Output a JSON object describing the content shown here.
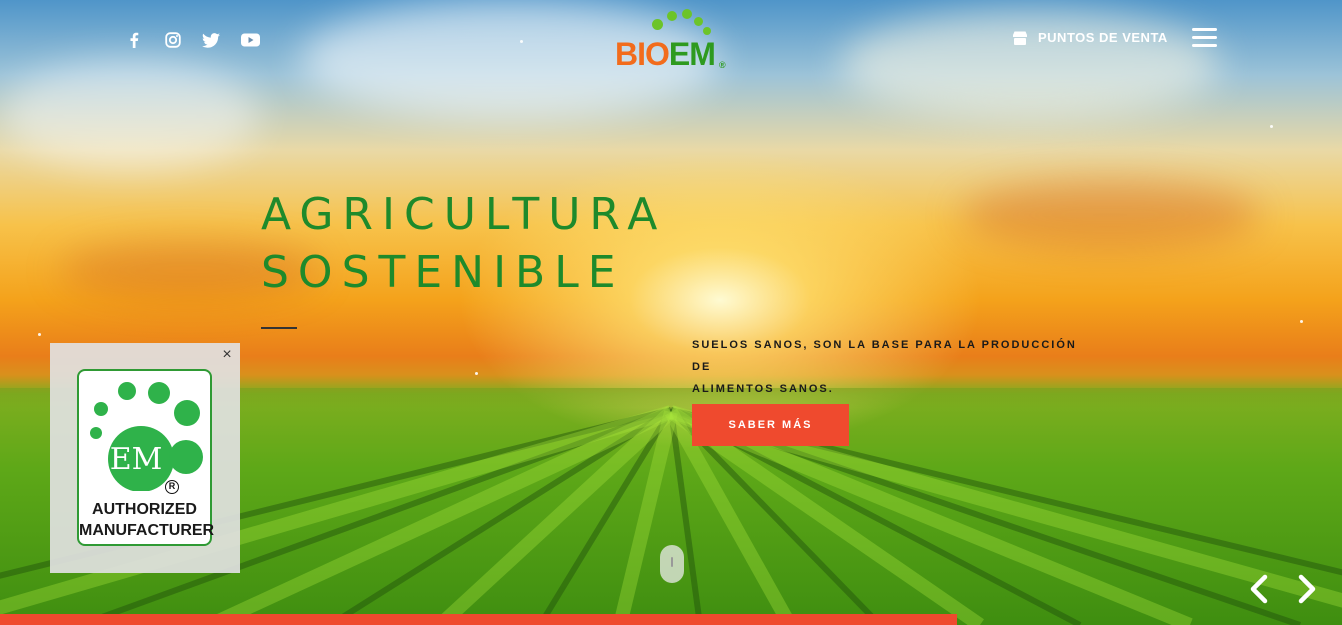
{
  "header": {
    "social": [
      {
        "icon": "facebook-icon"
      },
      {
        "icon": "instagram-icon"
      },
      {
        "icon": "twitter-icon"
      },
      {
        "icon": "youtube-icon"
      }
    ],
    "logo": {
      "part1": "BIO",
      "part2": "EM",
      "reg": "®"
    },
    "store_link": {
      "icon": "store-icon",
      "label": "PUNTOS DE VENTA"
    },
    "menu": {
      "icon": "hamburger-menu-icon"
    }
  },
  "hero": {
    "headline_line1": "AGRICULTURA",
    "headline_line2": "SOSTENIBLE",
    "tagline_line1": "SUELOS SANOS, SON LA BASE PARA LA PRODUCCIÓN DE",
    "tagline_line2": "ALIMENTOS SANOS.",
    "cta_label": "SABER MÁS",
    "progress": 0.713
  },
  "badge": {
    "close_label": "×",
    "em_label": "EM",
    "reg": "R",
    "line1": "AUTHORIZED",
    "line2": "MANUFACTURER"
  },
  "slider": {
    "prev_icon": "chevron-left-icon",
    "next_icon": "chevron-right-icon"
  },
  "colors": {
    "brand_green": "#1e8a2b",
    "brand_orange": "#f26c1c",
    "cta_red": "#ef4a2e"
  }
}
